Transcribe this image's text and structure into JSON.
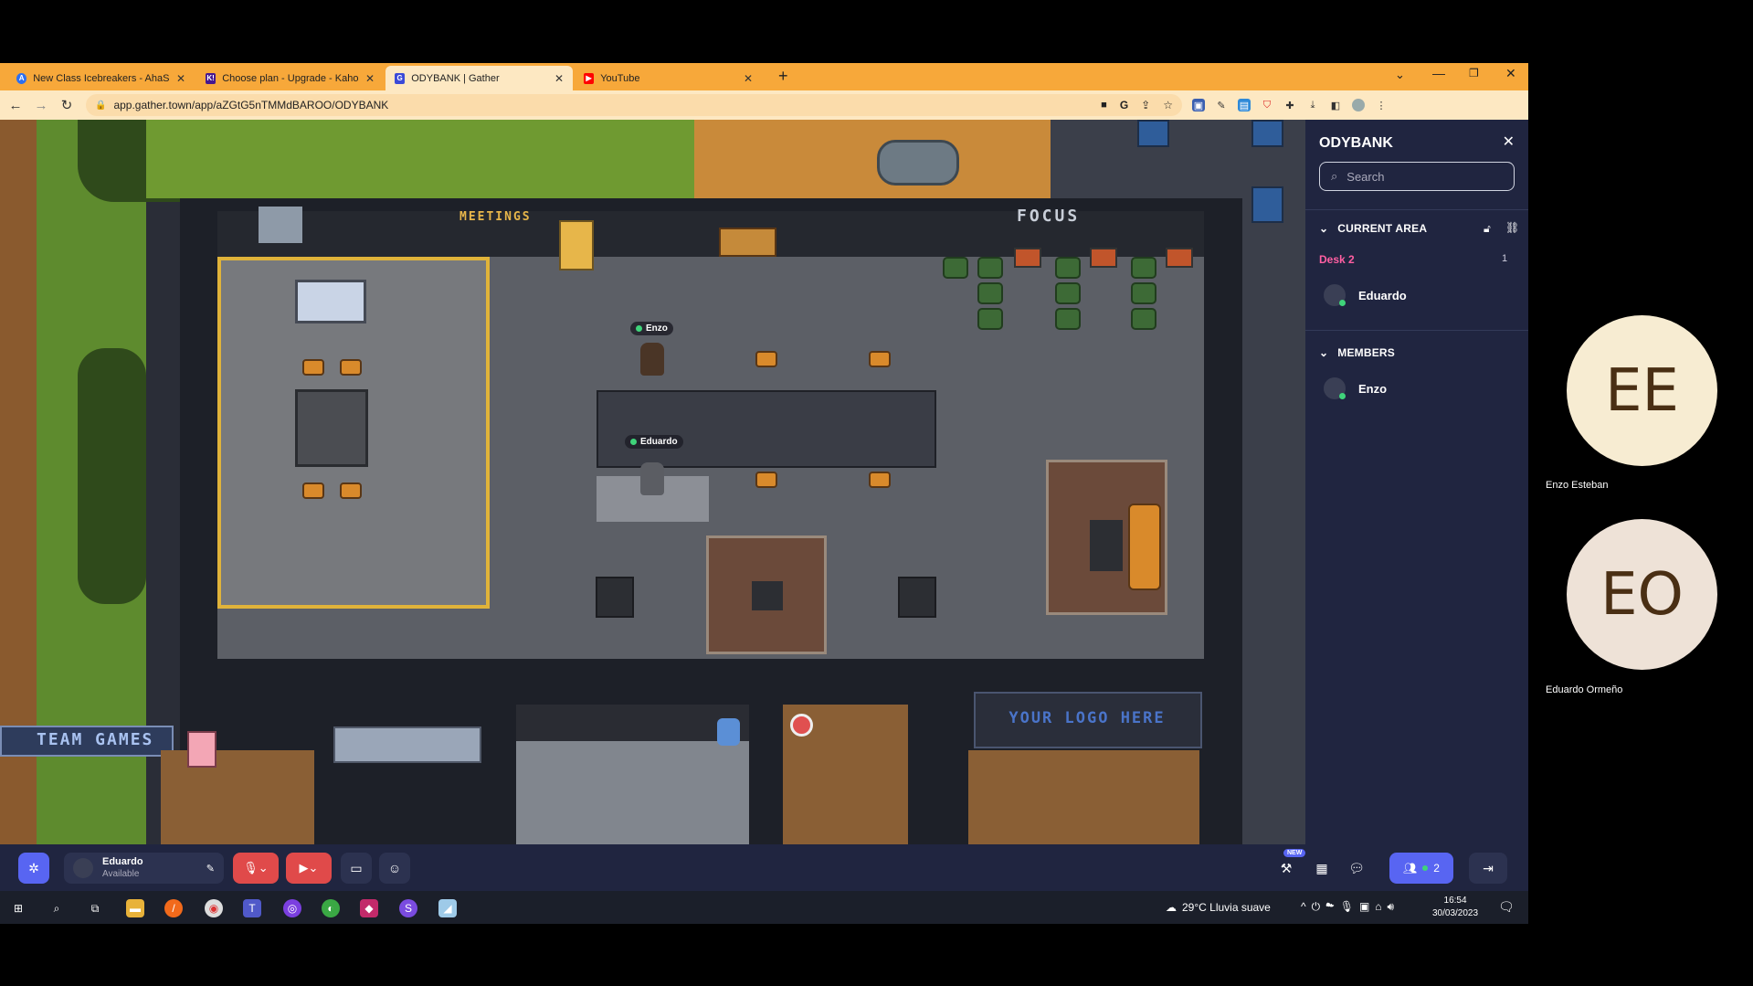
{
  "browser": {
    "tabs": [
      {
        "title": "New Class Icebreakers - AhaSlide",
        "favicon": "A"
      },
      {
        "title": "Choose plan - Upgrade - Kahoot!",
        "favicon": "K!"
      },
      {
        "title": "ODYBANK | Gather",
        "favicon": "G"
      },
      {
        "title": "YouTube",
        "favicon": "▶"
      }
    ],
    "new_tab": "+",
    "url": "app.gather.town/app/aZGtG5nTMMdBAROO/ODYBANK"
  },
  "map": {
    "signs": {
      "meetings": "MEETINGS",
      "focus": "FOCUS",
      "team_games": "TEAM GAMES",
      "your_logo": "YOUR LOGO HERE"
    },
    "players": [
      {
        "name": "Enzo"
      },
      {
        "name": "Eduardo"
      }
    ]
  },
  "panel": {
    "title": "ODYBANK",
    "search_placeholder": "Search",
    "current_area_label": "CURRENT AREA",
    "area_name": "Desk 2",
    "area_count": "1",
    "current_area_members": [
      "Eduardo"
    ],
    "members_label": "MEMBERS",
    "members": [
      "Enzo"
    ]
  },
  "bottom_bar": {
    "user_name": "Eduardo",
    "user_status": "Available",
    "new_badge": "NEW",
    "participants_count": "2"
  },
  "videos": [
    {
      "initials": "EE",
      "name": "Enzo Esteban",
      "bg": "#f7ecd2",
      "fg": "#4a2f14"
    },
    {
      "initials": "EO",
      "name": "Eduardo Ormeño",
      "bg": "#eee2d7",
      "fg": "#4a2f14"
    }
  ],
  "taskbar": {
    "weather": "29°C  Lluvia suave",
    "time": "16:54",
    "date": "30/03/2023"
  },
  "colors": {
    "tab_bar": "#f7a83a",
    "panel_bg": "#202540",
    "accent_pink": "#ff5fa2",
    "accent_blue": "#5865f2"
  }
}
